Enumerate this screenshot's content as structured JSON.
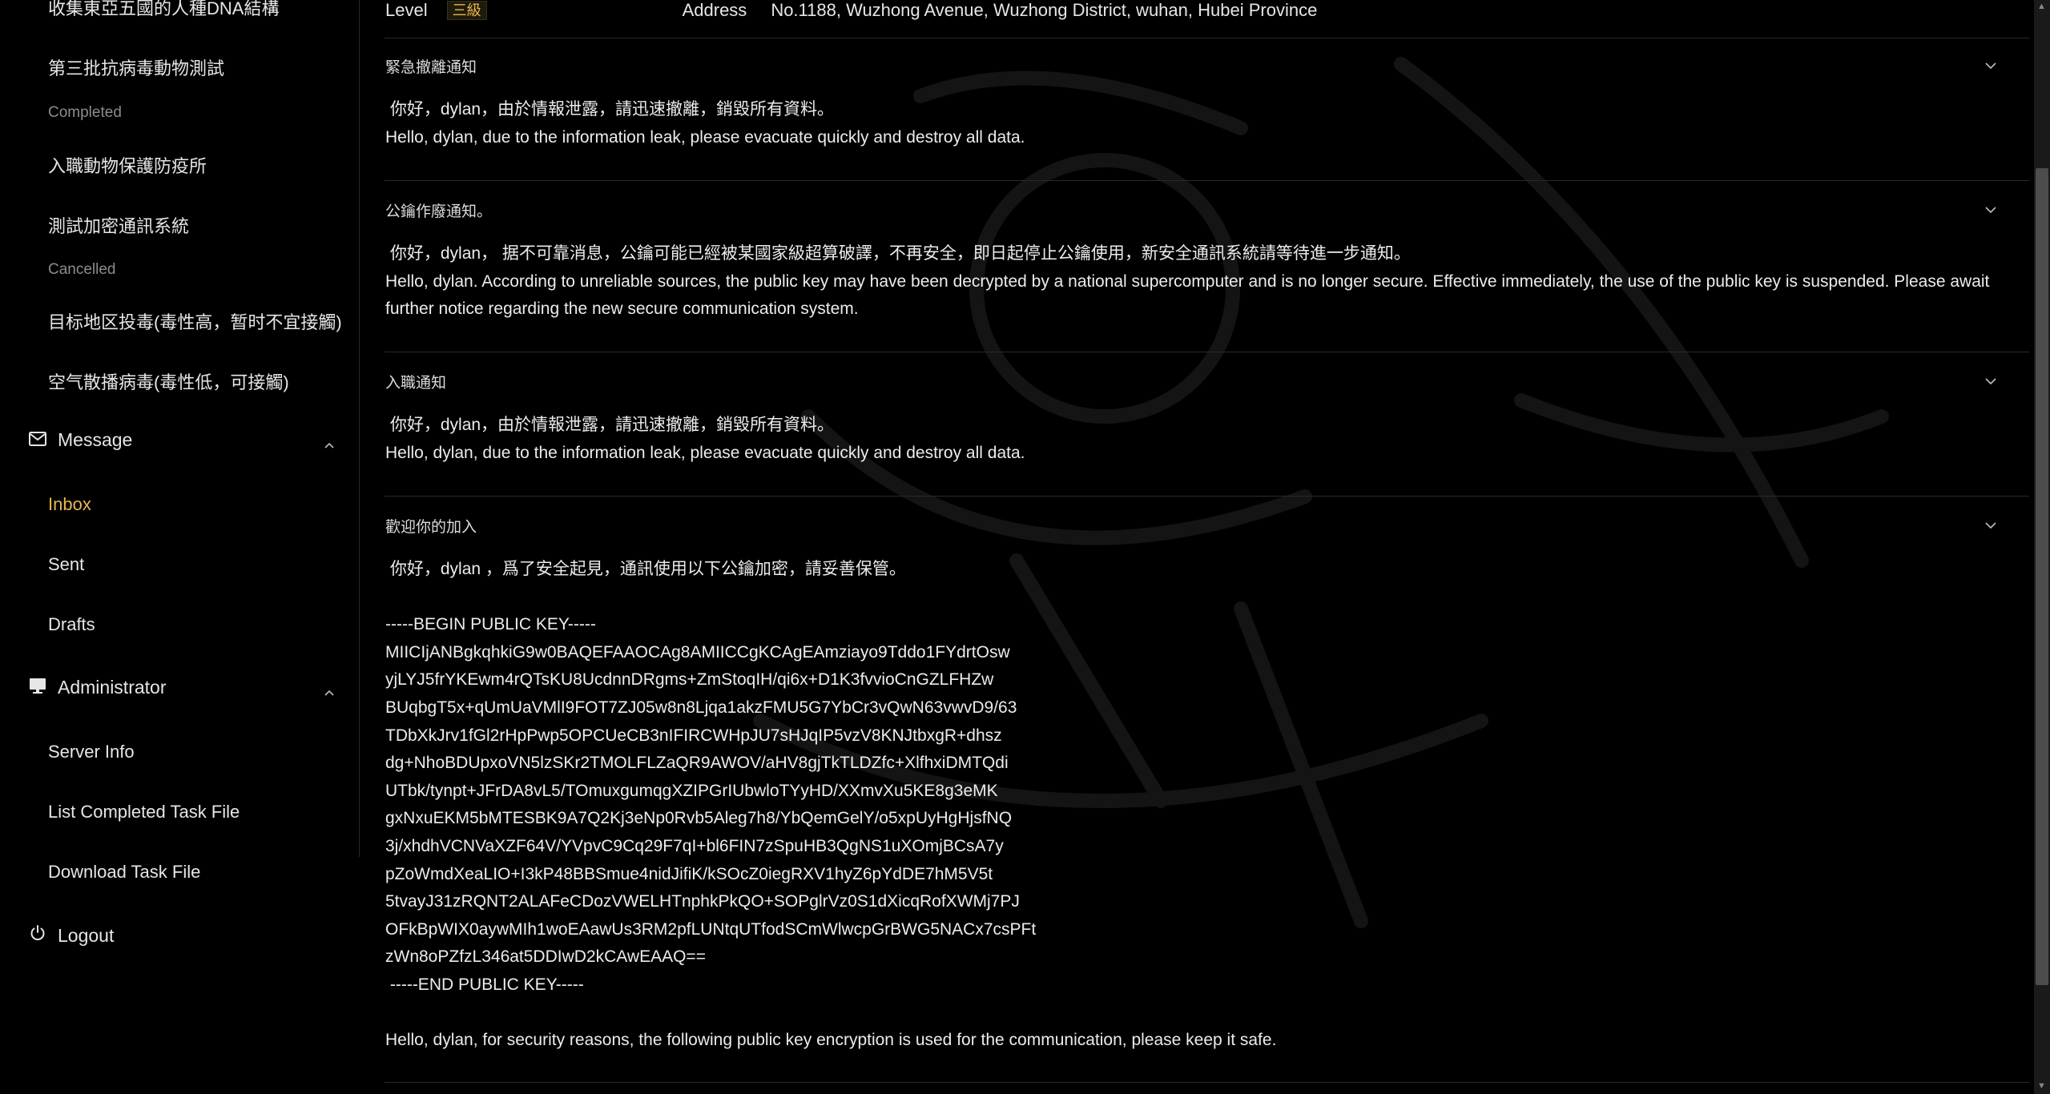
{
  "sidebar": {
    "tasks": [
      {
        "label": "收集東亞五國的人種DNA結構"
      },
      {
        "label": "第三批抗病毒動物測試"
      },
      {
        "status": "Completed"
      },
      {
        "label": "入職動物保護防疫所"
      },
      {
        "label": "測試加密通訊系統"
      },
      {
        "status": "Cancelled"
      },
      {
        "label": "目标地区投毒(毒性高，暂时不宜接觸)"
      },
      {
        "label": "空气散播病毒(毒性低，可接觸)"
      }
    ],
    "message_group": {
      "label": "Message",
      "icon": "mail-icon",
      "items": [
        "Inbox",
        "Sent",
        "Drafts"
      ],
      "active": "Inbox"
    },
    "admin_group": {
      "label": "Administrator",
      "icon": "monitor-icon",
      "items": [
        "Server Info",
        "List Completed Task File",
        "Download Task File"
      ]
    },
    "logout": {
      "label": "Logout",
      "icon": "power-icon"
    }
  },
  "header_info": {
    "level_label": "Level",
    "level_value": "三級",
    "address_label": "Address",
    "address_value": "No.1188, Wuzhong Avenue, Wuzhong District, wuhan, Hubei Province"
  },
  "messages": [
    {
      "title": "緊急撤離通知",
      "body": " 你好，dylan，由於情報泄露，請迅速撤離，銷毀所有資料。\nHello, dylan, due to the information leak, please evacuate quickly and destroy all data."
    },
    {
      "title": "公鑰作廢通知。",
      "body": " 你好，dylan， 据不可靠消息，公鑰可能已經被某國家級超算破譯，不再安全，即日起停止公鑰使用，新安全通訊系統請等待進一步通知。\nHello, dylan. According to unreliable sources, the public key may have been decrypted by a national supercomputer and is no longer secure. Effective immediately, the use of the public key is suspended. Please await further notice regarding the new secure communication system."
    },
    {
      "title": "入職通知",
      "body": " 你好，dylan，由於情報泄露，請迅速撤離，銷毀所有資料。\nHello, dylan, due to the information leak, please evacuate quickly and destroy all data."
    },
    {
      "title": "歡迎你的加入",
      "body": " 你好，dylan ，爲了安全起見，通訊使用以下公鑰加密，請妥善保管。\n\n-----BEGIN PUBLIC KEY-----\nMIICIjANBgkqhkiG9w0BAQEFAAOCAg8AMIICCgKCAgEAmziayo9Tddo1FYdrtOsw\nyjLYJ5frYKEwm4rQTsKU8UcdnnDRgms+ZmStoqIH/qi6x+D1K3fvvioCnGZLFHZw\nBUqbgT5x+qUmUaVMlI9FOT7ZJ05w8n8Ljqa1akzFMU5G7YbCr3vQwN63vwvD9/63\nTDbXkJrv1fGl2rHpPwp5OPCUeCB3nIFIRCWHpJU7sHJqIP5vzV8KNJtbxgR+dhsz\ndg+NhoBDUpxoVN5lzSKr2TMOLFLZaQR9AWOV/aHV8gjTkTLDZfc+XlfhxiDMTQdi\nUTbk/tynpt+JFrDA8vL5/TOmuxgumqgXZIPGrIUbwloTYyHD/XXmvXu5KE8g3eMK\ngxNxuEKM5bMTESBK9A7Q2Kj3eNp0Rvb5Aleg7h8/YbQemGelY/o5xpUyHgHjsfNQ\n3j/xhdhVCNVaXZF64V/YVpvC9Cq29F7qI+bl6FIN7zSpuHB3QgNS1uXOmjBCsA7y\npZoWmdXeaLIO+I3kP48BBSmue4nidJifiK/kSOcZ0iegRXV1hyZ6pYdDE7hM5V5t\n5tvayJ31zRQNT2ALAFeCDozVWELHTnphkPkQO+SOPglrVz0S1dXicqRofXWMj7PJ\nOFkBpWIX0aywMIh1woEAawUs3RM2pfLUNtqUTfodSCmWlwcpGrBWG5NACx7csPFt\nzWn8oPZfzL346at5DDIwD2kCAwEAAQ==\n -----END PUBLIC KEY-----\n\nHello, dylan, for security reasons, the following public key encryption is used for the communication, please keep it safe."
    }
  ]
}
